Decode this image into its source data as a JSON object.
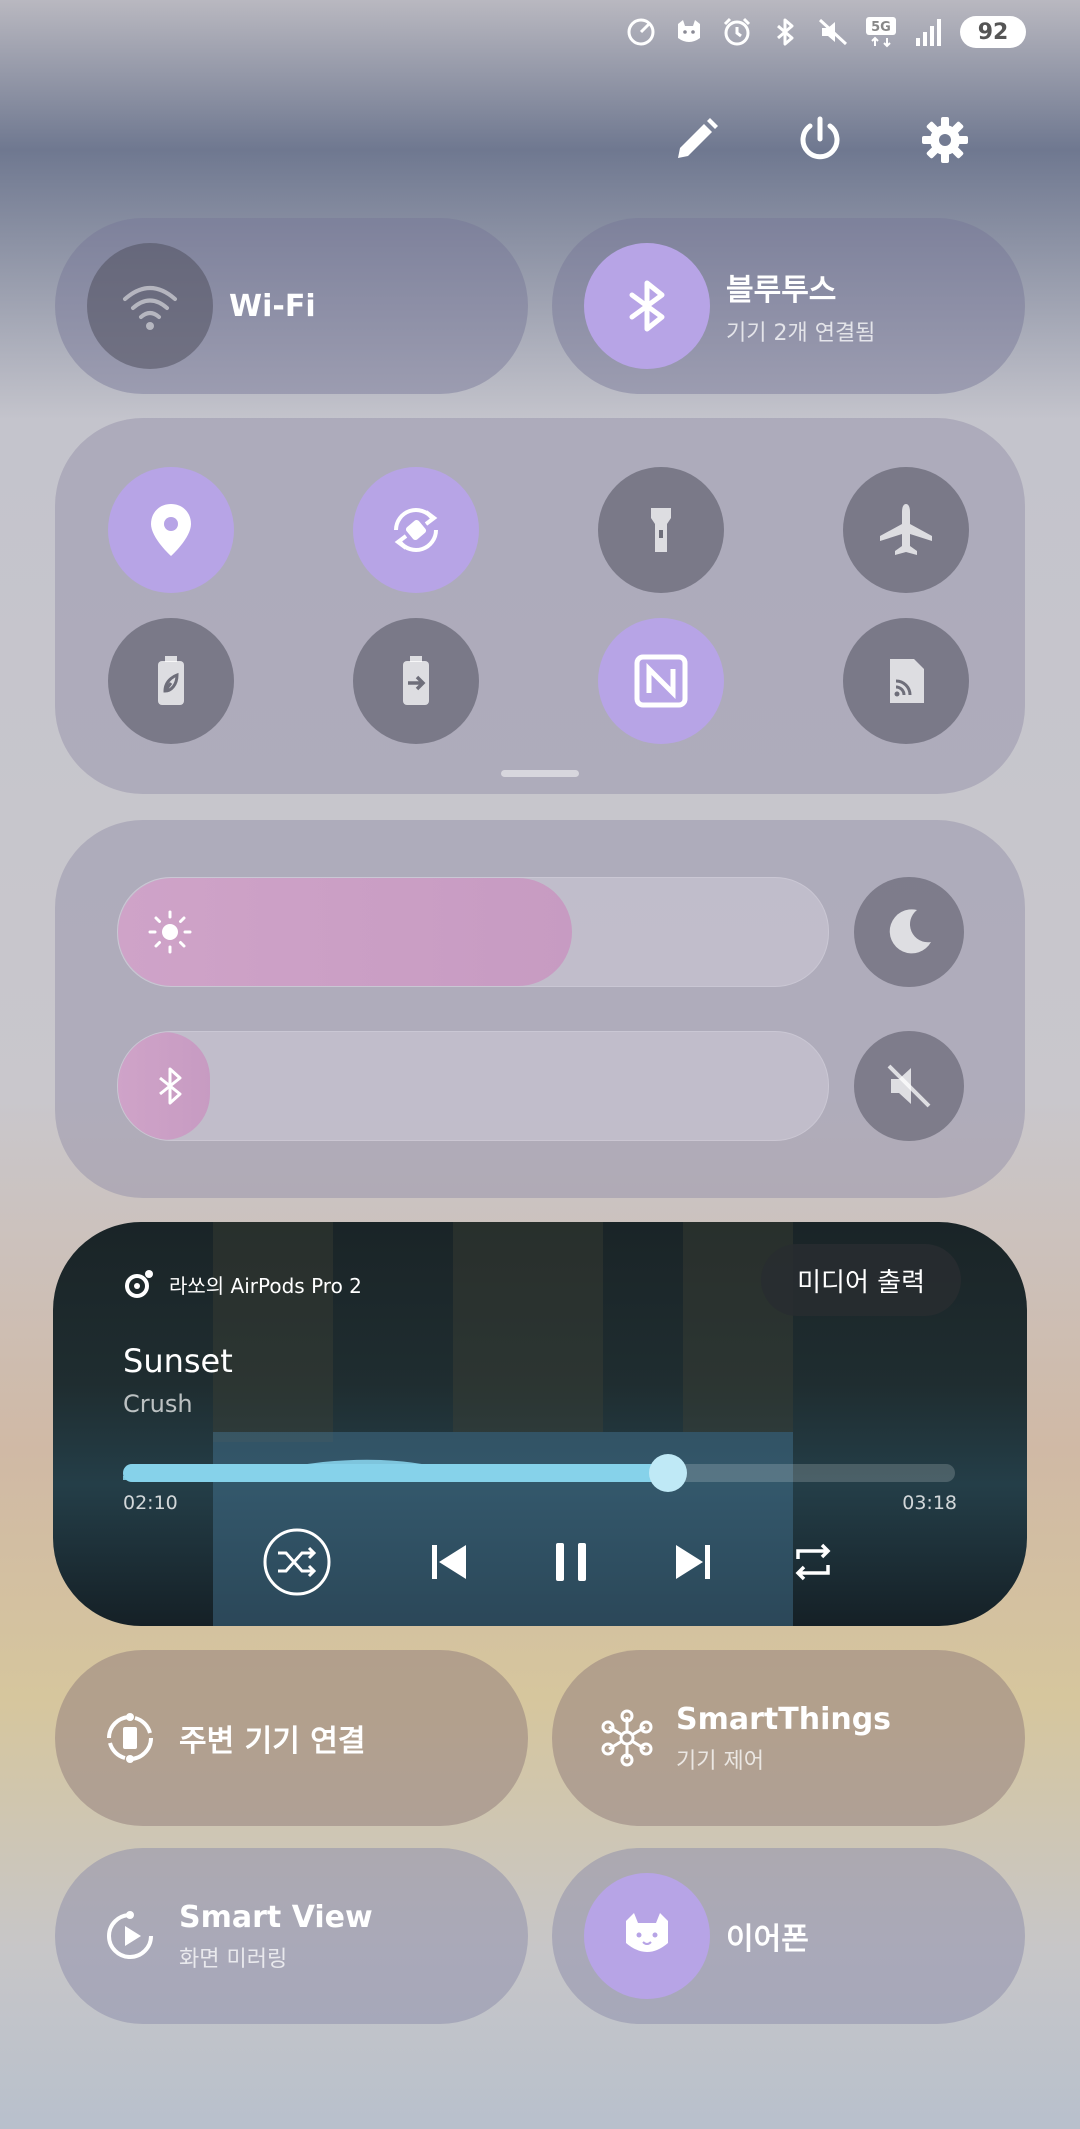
{
  "status_bar": {
    "battery": "92",
    "network": "5G",
    "icons": [
      "data-saver-icon",
      "cat-app-icon",
      "alarm-icon",
      "bluetooth-icon",
      "mute-icon",
      "5g-icon",
      "signal-icon",
      "battery-icon"
    ]
  },
  "top_actions": {
    "icons": [
      "edit-icon",
      "power-icon",
      "settings-icon"
    ]
  },
  "wifi": {
    "label": "Wi-Fi",
    "active": false
  },
  "bluetooth": {
    "label": "블루투스",
    "status": "기기 2개 연결됨",
    "active": true
  },
  "quick_tiles": [
    {
      "name": "location",
      "icon": "location-pin-icon",
      "active": true
    },
    {
      "name": "auto-rotate",
      "icon": "auto-rotate-icon",
      "active": true
    },
    {
      "name": "flashlight",
      "icon": "flashlight-icon",
      "active": false
    },
    {
      "name": "airplane-mode",
      "icon": "airplane-icon",
      "active": false
    },
    {
      "name": "power-saving",
      "icon": "battery-leaf-icon",
      "active": false
    },
    {
      "name": "power-share",
      "icon": "battery-share-icon",
      "active": false
    },
    {
      "name": "nfc",
      "icon": "nfc-icon",
      "active": true
    },
    {
      "name": "cast",
      "icon": "cast-icon",
      "active": false
    }
  ],
  "sliders": {
    "brightness": {
      "level": 0.64,
      "icon": "sun-icon"
    },
    "volume": {
      "level": 0.1,
      "icon": "bluetooth-icon"
    },
    "night_mode_icon": "moon-icon",
    "sound_icon": "mute-icon"
  },
  "media": {
    "device": "라쏘의 AirPods Pro 2",
    "output_button": "미디어 출력",
    "title": "Sunset",
    "artist": "Crush",
    "elapsed": "02:10",
    "duration": "03:18",
    "progress": 0.655,
    "controls": [
      "shuffle-icon",
      "previous-icon",
      "pause-icon",
      "next-icon",
      "repeat-icon"
    ]
  },
  "nearby": {
    "label": "주변 기기 연결"
  },
  "smartthings": {
    "label": "SmartThings",
    "sub": "기기 제어"
  },
  "smartview": {
    "label": "Smart View",
    "sub": "화면 미러링"
  },
  "earphones": {
    "label": "이어폰"
  },
  "colors": {
    "accent": "#b7a4e6",
    "progress": "#86d2ea",
    "brightness_fill": "#cfa3c8"
  }
}
